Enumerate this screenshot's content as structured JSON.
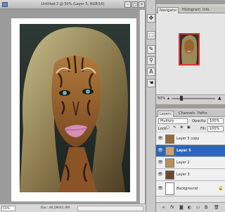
{
  "document": {
    "title": "Untitled-3 @ 50% (Layer 5, RGB/16)",
    "zoom": "50%",
    "doc_info": "Doc: 46.2M/41.0M"
  },
  "toolstrip": {
    "icons": [
      "move-icon",
      "marquee-icon",
      "brush-icon",
      "stamp-icon",
      "text-icon",
      "hand-icon"
    ]
  },
  "navigator": {
    "tabs": [
      "Navigator",
      "Histogram",
      "Info"
    ],
    "zoom": "50%"
  },
  "layers": {
    "tabs": [
      "Layers",
      "Channels",
      "Paths"
    ],
    "blend_mode": "Multiply",
    "opacity_label": "Opacity:",
    "opacity_value": "100%",
    "lock_label": "Lock:",
    "fill_label": "Fill:",
    "fill_value": "100%",
    "items": [
      {
        "name": "Layer 5 copy",
        "selected": false
      },
      {
        "name": "Layer 5",
        "selected": true
      },
      {
        "name": "Layer 2",
        "selected": false
      },
      {
        "name": "Layer 3",
        "selected": false
      },
      {
        "name": "Background",
        "selected": false
      }
    ]
  },
  "colors": {
    "selection": "#2d66b8",
    "nav_frame": "#e03030"
  }
}
